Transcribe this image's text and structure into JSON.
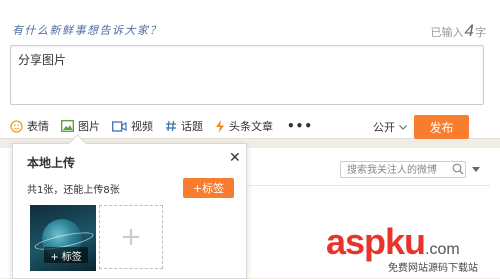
{
  "composer": {
    "prompt": "有什么新鲜事想告诉大家？",
    "counter_prefix": "已输入",
    "counter_value": "4",
    "counter_suffix": "字",
    "text": "分享图片"
  },
  "toolbar": {
    "items": [
      {
        "label": "表情",
        "icon": "smiley-icon"
      },
      {
        "label": "图片",
        "icon": "image-icon"
      },
      {
        "label": "视频",
        "icon": "video-icon"
      },
      {
        "label": "话题",
        "icon": "hashtag-icon"
      },
      {
        "label": "头条文章",
        "icon": "lightning-icon"
      }
    ],
    "more": "•••",
    "visibility": "公开",
    "publish": "发布"
  },
  "feed_filter": {
    "search_placeholder": "搜索我关注人的微博"
  },
  "upload_popup": {
    "title": "本地上传",
    "info": "共1张，还能上传8张",
    "tag_button": "+标签",
    "thumb_tag": "+ 标签",
    "add_symbol": "+"
  },
  "watermark": {
    "main": "aspku",
    "suffix": ".com",
    "sub": "免费网站源码下载站"
  },
  "colors": {
    "accent": "#f97d2e",
    "prompt": "#4e6d9e",
    "background": "#f0ece6"
  }
}
